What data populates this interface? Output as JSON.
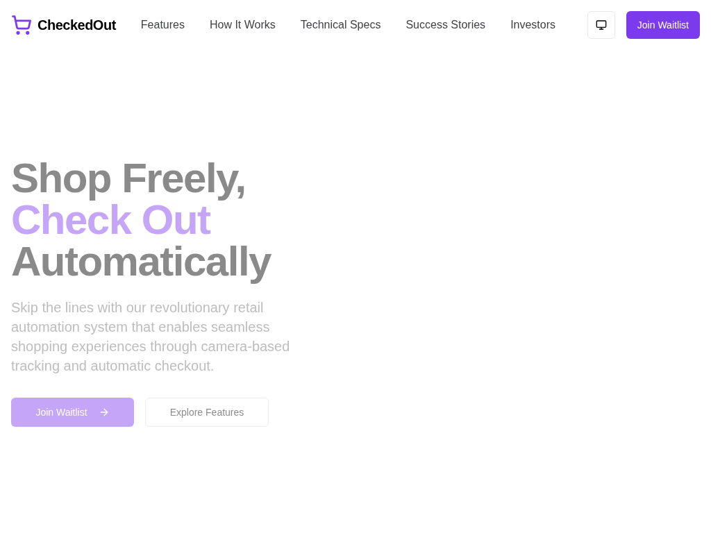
{
  "nav": {
    "brand": "CheckedOut",
    "links": [
      "Features",
      "How It Works",
      "Technical Specs",
      "Success Stories",
      "Investors"
    ],
    "cta": "Join Waitlist"
  },
  "hero": {
    "headline": [
      {
        "text": "Shop Freely,",
        "highlight": false
      },
      {
        "text": "Check Out",
        "highlight": true
      },
      {
        "text": "Automatically",
        "highlight": false
      }
    ],
    "description": "Skip the lines with our revolutionary retail automation system that enables seamless shopping experiences through camera-based tracking and automatic checkout.",
    "buttons": [
      {
        "label": "Join Waitlist",
        "kind": "primary"
      },
      {
        "label": "Explore Features",
        "kind": "secondary"
      }
    ]
  }
}
